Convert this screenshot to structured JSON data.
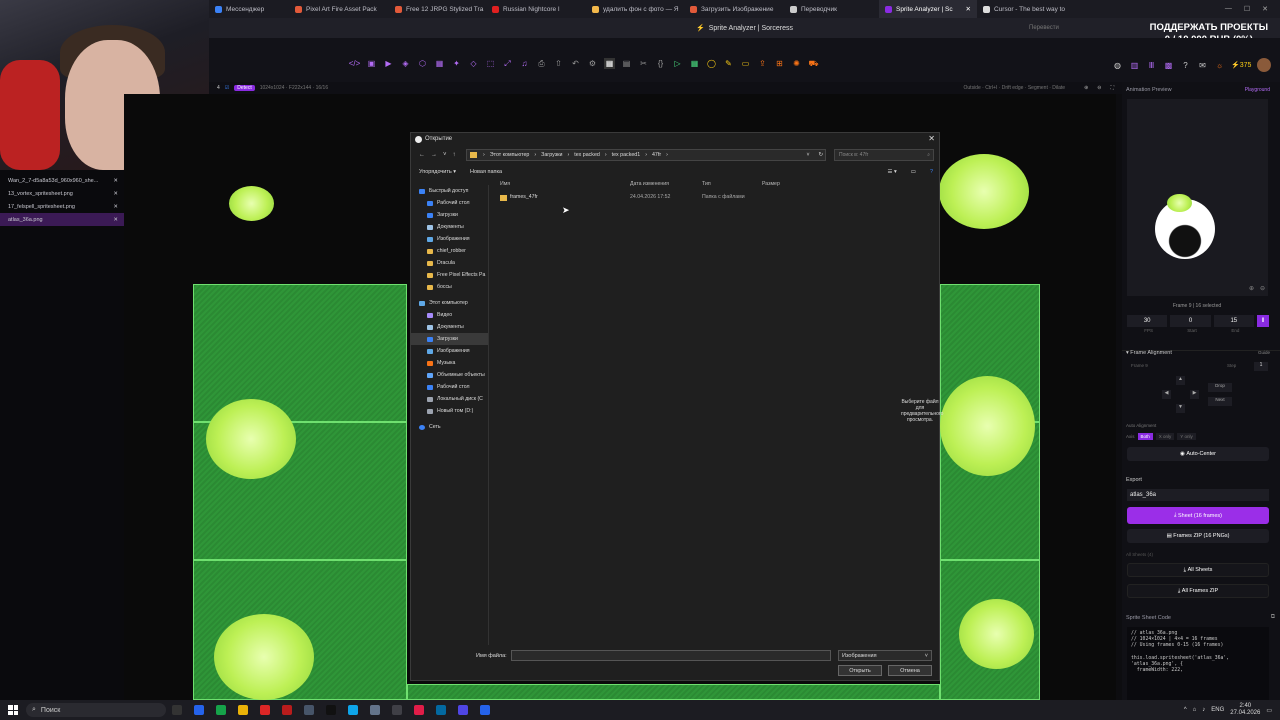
{
  "browser": {
    "tabs": [
      {
        "label": "Мессенджер",
        "color": "#3b82f6"
      },
      {
        "label": "Pixel Art Fire Asset Pack",
        "color": "#e25a3a"
      },
      {
        "label": "Free 12 JRPG Stylized Tra",
        "color": "#e25a3a"
      },
      {
        "label": "Russian Nightcore I",
        "color": "#e02020"
      },
      {
        "label": "удалить фон с фото — Я",
        "color": "#f2b84b"
      },
      {
        "label": "Загрузить Изображение",
        "color": "#e25a3a"
      },
      {
        "label": "Переводчик",
        "color": "#cccccc"
      },
      {
        "label": "Sprite Analyzer | Sc",
        "color": "#8a2be2"
      },
      {
        "label": "Cursor - The best way to",
        "color": "#dddddd"
      }
    ],
    "page_title": "Sprite Analyzer | Sorceress",
    "donate_line1": "ПОДДЕРЖАТЬ ПРОЕКТЫ",
    "donate_line2": "0 / 10 000 RUB (0%)",
    "search_hint": "Перевести"
  },
  "app": {
    "credits": "375",
    "frame_number": "4",
    "detect_label": "Detect",
    "sub_info": "1024x1024  ·  F222x144  ·  16/16",
    "sub_right": "Outside  ·  Ctrl+I  ·  Drift edge  ·  Segment  ·  Dilate",
    "files": [
      "Wan_2_7-d5a8a53d_960x960_she...",
      "13_vortex_spritesheet.png",
      "17_felspell_spritesheet.png",
      "atlas_36a.png"
    ]
  },
  "right_panel": {
    "animation_preview": "Animation Preview",
    "playground": "Playground",
    "frame_status": "Frame 9 | 16 selected",
    "fps_value": "30",
    "start_value": "0",
    "end_value": "15",
    "fps_label": "FPS",
    "start_label": "Start",
    "end_label": "End",
    "frame_alignment": "Frame Alignment",
    "guide": "Guide",
    "frame_label": "Frame 9",
    "step_label": "Step",
    "step_value": "1",
    "drop_label": "Drop",
    "next_label": "Next",
    "auto_alignment": "Auto Alignment",
    "axis_label": "Axis",
    "axis_both": "Both",
    "axis_x": "X only",
    "axis_y": "Y only",
    "auto_center": "Auto-Center",
    "export": "Export",
    "export_name": "atlas_36a",
    "sheet_btn": "Sheet (16 frames)",
    "frames_zip_btn": "Frames ZIP (16 PNGs)",
    "all_sheets_hdr": "All Sheets (4)",
    "all_sheets_btn": "All Sheets",
    "all_frames_btn": "All Frames ZIP",
    "code_title": "Sprite Sheet Code",
    "code_lines": [
      "// atlas_36a.png",
      "// 1024×1024 | 4×4 = 16 frames",
      "// Using frames 0-15 (16 frames)",
      "",
      "this.load.spritesheet('atlas_36a',",
      "'atlas_36a.png', {",
      "  frameWidth: 222,"
    ]
  },
  "dialog": {
    "title": "Открытие",
    "path": [
      "Этот компьютер",
      "Загрузки",
      "tex packed",
      "tex packed1",
      "47fr"
    ],
    "search_placeholder": "Поиск в: 47fr",
    "organize": "Упорядочить",
    "new_folder": "Новая папка",
    "nav": {
      "quick_access": "Быстрый доступ",
      "quick": [
        "Рабочий стол",
        "Загрузки",
        "Документы",
        "Изображения",
        "chief_robber",
        "Dracula",
        "Free Pixel Effects Pa",
        "боссы"
      ],
      "this_pc": "Этот компьютер",
      "pc": [
        "Видео",
        "Документы",
        "Загрузки",
        "Изображения",
        "Музыка",
        "Объемные объекты",
        "Рабочий стол",
        "Локальный диск (C",
        "Новый том (D:)"
      ],
      "network": "Сеть"
    },
    "columns": {
      "name": "Имя",
      "modified": "Дата изменения",
      "type": "Тип",
      "size": "Размер"
    },
    "rows": [
      {
        "name": "frames_47fr",
        "modified": "24.04.2026 17:52",
        "type": "Папка с файлами"
      }
    ],
    "preview_note": "Выберите файл для предварительного просмотра.",
    "filename_label": "Имя файла:",
    "filetype": "Изображения",
    "open_btn": "Открыть",
    "cancel_btn": "Отмена"
  },
  "taskbar": {
    "search": "Поиск",
    "lang": "ENG",
    "time": "2:40",
    "date": "27.04.2026"
  }
}
